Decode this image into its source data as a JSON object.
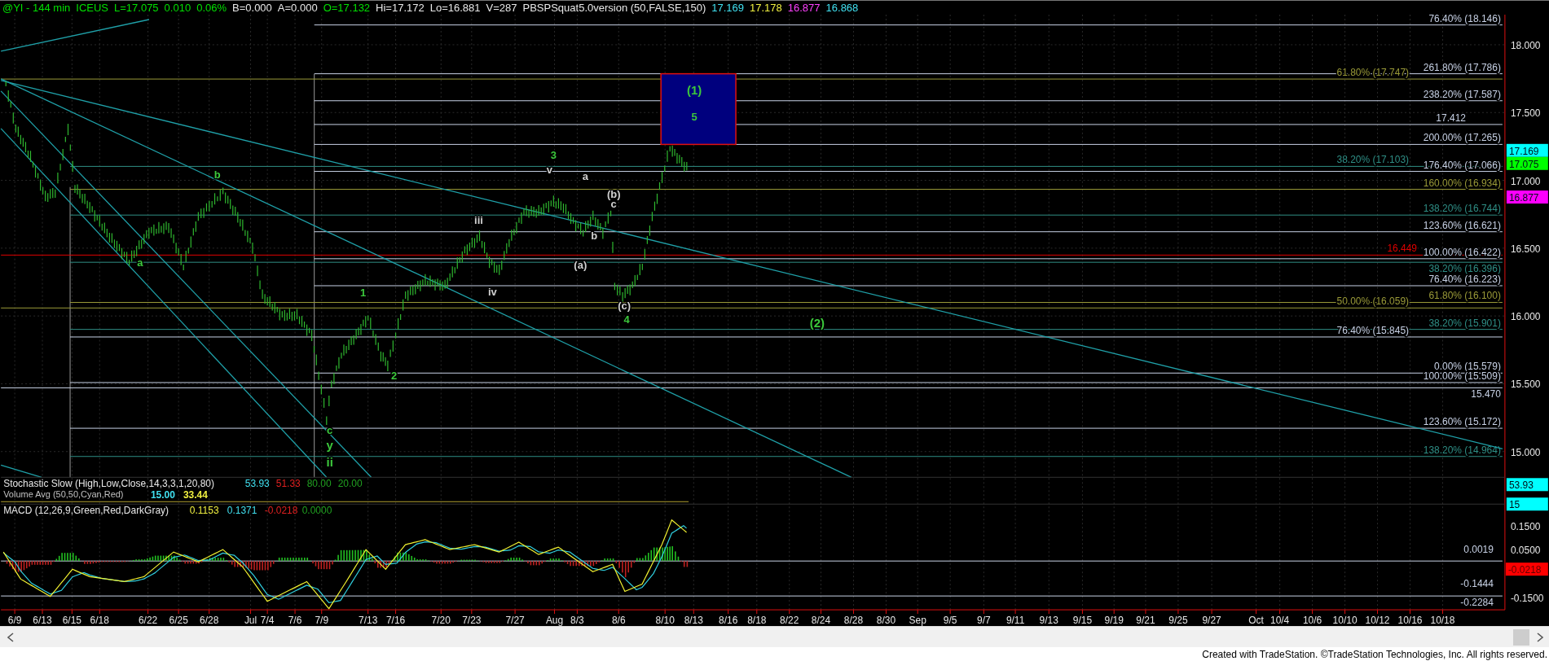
{
  "header": {
    "items": [
      {
        "text": "@YI - 144 min",
        "color": "#00e000"
      },
      {
        "text": "ICEUS",
        "color": "#00e000"
      },
      {
        "text": "L=17.075",
        "color": "#00e000"
      },
      {
        "text": "0.010",
        "color": "#00e000"
      },
      {
        "text": "0.06%",
        "color": "#00e000"
      },
      {
        "text": "B=0.000",
        "color": "#e8e8e8"
      },
      {
        "text": "A=0.000",
        "color": "#e8e8e8"
      },
      {
        "text": "O=17.132",
        "color": "#00e000"
      },
      {
        "text": "Hi=17.172",
        "color": "#e8e8e8"
      },
      {
        "text": "Lo=16.881",
        "color": "#e8e8e8"
      },
      {
        "text": "V=287",
        "color": "#e8e8e8"
      },
      {
        "text": "PBSPSquat5.0version (50,FALSE,150)",
        "color": "#e8e8e8"
      },
      {
        "text": "17.169",
        "color": "#40e0f0"
      },
      {
        "text": "17.178",
        "color": "#f0f040"
      },
      {
        "text": "16.877",
        "color": "#ff40ff"
      },
      {
        "text": "16.868",
        "color": "#40e0f0"
      }
    ]
  },
  "price_pane": {
    "axis_ticks": [
      "18.000",
      "17.500",
      "17.000",
      "16.500",
      "16.000",
      "15.500",
      "15.000"
    ],
    "value_tags": [
      {
        "text": "17.169",
        "color": "#00ffff"
      },
      {
        "text": "17.075",
        "color": "#00ff00"
      },
      {
        "text": "16.877",
        "color": "#ff00ff"
      }
    ],
    "levels": [
      {
        "text": "76.40% (18.146)",
        "color": "#c8d2e6"
      },
      {
        "text": "261.80% (17.786)",
        "color": "#c8d2e6"
      },
      {
        "text": "61.80% (17.747)",
        "color": "#9a9a38"
      },
      {
        "text": "238.20% (17.587)",
        "color": "#c8d2e6"
      },
      {
        "text": "17.412",
        "color": "#c8d2e6"
      },
      {
        "text": "200.00% (17.265)",
        "color": "#c8d2e6"
      },
      {
        "text": "38.20% (17.103)",
        "color": "#2f8f86"
      },
      {
        "text": "176.40% (17.066)",
        "color": "#c8d2e6"
      },
      {
        "text": "160.00% (16.934)",
        "color": "#9a9a38"
      },
      {
        "text": "138.20% (16.744)",
        "color": "#2f8f86"
      },
      {
        "text": "123.60% (16.621)",
        "color": "#c8d2e6"
      },
      {
        "text": "16.449",
        "color": "#e00000"
      },
      {
        "text": "100.00% (16.422)",
        "color": "#c8d2e6"
      },
      {
        "text": "38.20% (16.396)",
        "color": "#2f8f86"
      },
      {
        "text": "76.40% (16.223)",
        "color": "#c8d2e6"
      },
      {
        "text": "61.80% (16.100)",
        "color": "#9a9a38"
      },
      {
        "text": "50.00% (16.059)",
        "color": "#9a9a38"
      },
      {
        "text": "38.20% (15.901)",
        "color": "#2f8f86"
      },
      {
        "text": "76.40% (15.845)",
        "color": "#c8d2e6"
      },
      {
        "text": "0.00% (15.579)",
        "color": "#c8d2e6"
      },
      {
        "text": "100.00% (15.509)",
        "color": "#c8d2e6"
      },
      {
        "text": "15.470",
        "color": "#c8d2e6"
      },
      {
        "text": "123.60% (15.172)",
        "color": "#c8d2e6"
      },
      {
        "text": "138.20% (14.964)",
        "color": "#2f8f86"
      }
    ],
    "target_box": {
      "label": "(1)",
      "sublabel": "5"
    },
    "wave_labels": [
      {
        "text": "3",
        "color": "#3cc83c",
        "kind": "minor"
      },
      {
        "text": "v",
        "color": "#d0d0d0",
        "kind": "minor"
      },
      {
        "text": "b",
        "color": "#3cc83c",
        "kind": "minor"
      },
      {
        "text": "a",
        "color": "#d0d0d0",
        "kind": "minor"
      },
      {
        "text": "(b)",
        "color": "#d0d0d0",
        "kind": "minor"
      },
      {
        "text": "c",
        "color": "#d0d0d0",
        "kind": "minor"
      },
      {
        "text": "iii",
        "color": "#d0d0d0",
        "kind": "minor"
      },
      {
        "text": "b",
        "color": "#d0d0d0",
        "kind": "minor"
      },
      {
        "text": "a",
        "color": "#3cc83c",
        "kind": "minor"
      },
      {
        "text": "(a)",
        "color": "#d0d0d0",
        "kind": "minor"
      },
      {
        "text": "iv",
        "color": "#d0d0d0",
        "kind": "minor"
      },
      {
        "text": "1",
        "color": "#3cc83c",
        "kind": "minor"
      },
      {
        "text": "(c)",
        "color": "#d0d0d0",
        "kind": "minor"
      },
      {
        "text": "4",
        "color": "#3cc83c",
        "kind": "minor"
      },
      {
        "text": "(2)",
        "color": "#3cc83c",
        "kind": "major"
      },
      {
        "text": "2",
        "color": "#3cc83c",
        "kind": "minor"
      },
      {
        "text": "c",
        "color": "#3cc83c",
        "kind": "minor"
      },
      {
        "text": "y",
        "color": "#3cc83c",
        "kind": "major"
      },
      {
        "text": "ii",
        "color": "#3cc83c",
        "kind": "major"
      }
    ]
  },
  "stochastic_pane": {
    "title": "Stochastic Slow (High,Low,Close,14,3,3,1,20,80)",
    "values": [
      {
        "text": "53.93",
        "color": "#40e0f0"
      },
      {
        "text": "51.33",
        "color": "#e02020"
      },
      {
        "text": "80.00",
        "color": "#20a020"
      },
      {
        "text": "20.00",
        "color": "#20a020"
      }
    ],
    "volume_title": "Volume Avg (50,50,Cyan,Red)",
    "volume_values": [
      {
        "text": "15.00",
        "color": "#40e0f0"
      },
      {
        "text": "33.44",
        "color": "#f0f040"
      }
    ],
    "value_tags": [
      {
        "text": "53.93",
        "color": "#00ffff"
      },
      {
        "text": "15",
        "color": "#00ffff"
      }
    ]
  },
  "macd_pane": {
    "title": "MACD (12,26,9,Green,Red,DarkGray)",
    "values": [
      {
        "text": "0.1153",
        "color": "#f0f040"
      },
      {
        "text": "0.1371",
        "color": "#40e0f0"
      },
      {
        "text": "-0.0218",
        "color": "#e02020"
      },
      {
        "text": "0.0000",
        "color": "#20a020"
      }
    ],
    "axis_ticks": [
      "0.1500",
      "0.0500",
      "-0.1500"
    ],
    "levels": [
      "0.0019",
      "-0.1444",
      "-0.2284"
    ],
    "value_tags": [
      {
        "text": "-0.0218",
        "color": "#ff0000"
      }
    ]
  },
  "date_axis": [
    "6/9",
    "6/13",
    "6/15",
    "6/18",
    "6/22",
    "6/25",
    "6/28",
    "Jul",
    "7/4",
    "7/6",
    "7/9",
    "7/13",
    "7/16",
    "7/20",
    "7/23",
    "7/27",
    "Aug",
    "8/3",
    "8/6",
    "8/10",
    "8/13",
    "8/16",
    "8/18",
    "8/22",
    "8/24",
    "8/28",
    "8/30",
    "Sep",
    "9/5",
    "9/7",
    "9/11",
    "9/13",
    "9/15",
    "9/19",
    "9/21",
    "9/25",
    "9/27",
    "Oct",
    "10/4",
    "10/6",
    "10/10",
    "10/12",
    "10/16",
    "10/18"
  ],
  "footer": "Created with TradeStation. ©TradeStation Technologies, Inc. All rights reserved."
}
